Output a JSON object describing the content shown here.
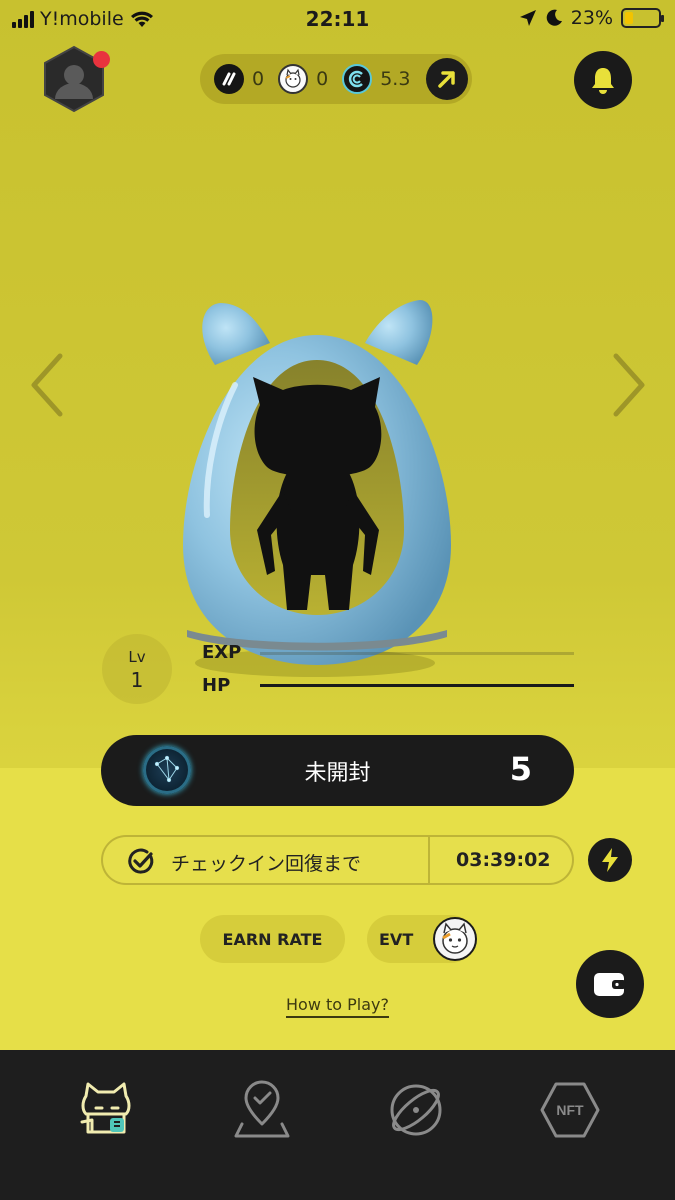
{
  "status_bar": {
    "carrier": "Y!mobile",
    "time": "22:11",
    "battery": "23%",
    "battery_level": 0.23
  },
  "header": {
    "currencies": [
      {
        "icon": "gst-token-icon",
        "value": "0"
      },
      {
        "icon": "cat-token-icon",
        "value": "0"
      },
      {
        "icon": "gmt-token-icon",
        "value": "5.3"
      }
    ]
  },
  "character": {
    "level_label": "Lv",
    "level_value": "1",
    "exp_label": "EXP",
    "exp_progress": 0.0,
    "hp_label": "HP",
    "hp_progress": 1.0
  },
  "status": {
    "label": "未開封",
    "count": "5"
  },
  "checkin": {
    "label": "チェックイン回復まで",
    "timer": "03:39:02"
  },
  "buttons": {
    "earn_rate": "EARN RATE",
    "evt": "EVT"
  },
  "help_link": "How to Play?",
  "tabs": [
    {
      "icon": "lucky-cat-icon",
      "active": true
    },
    {
      "icon": "map-pin-check-icon",
      "active": false
    },
    {
      "icon": "atom-orbit-icon",
      "active": false
    },
    {
      "icon": "nft-hexagon-icon",
      "label": "NFT",
      "active": false
    }
  ],
  "colors": {
    "background": "#cfc836",
    "dark": "#1b1b1b",
    "tab_active": "#f1ecb0",
    "notification": "#e8333e"
  }
}
